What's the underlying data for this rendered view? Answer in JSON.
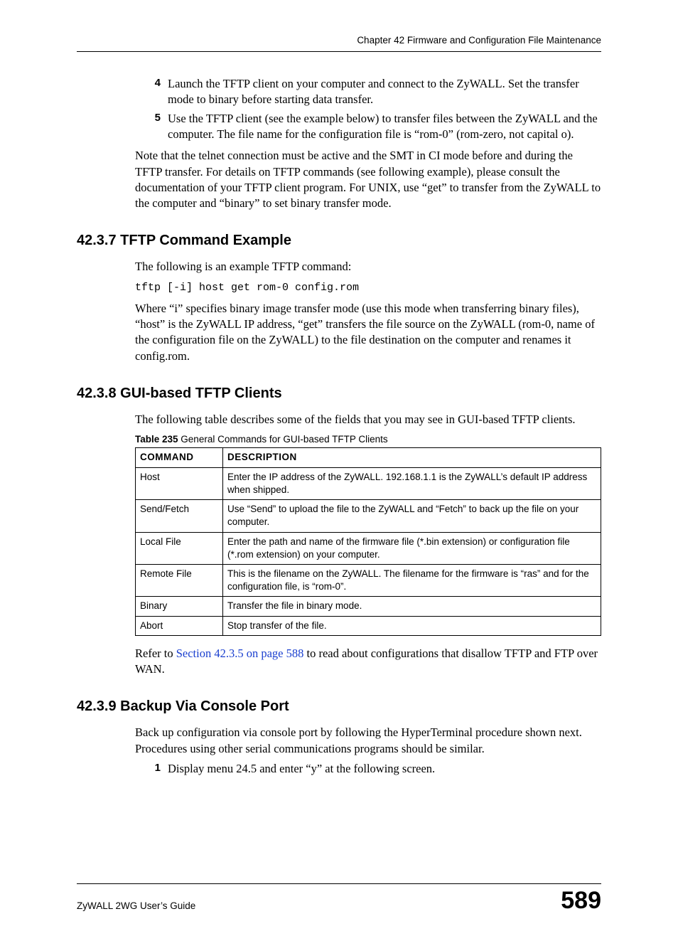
{
  "header": "Chapter 42 Firmware and Configuration File Maintenance",
  "steps_a": [
    {
      "n": "4",
      "t": "Launch the TFTP client on your computer and connect to the ZyWALL. Set the transfer mode to binary before starting data transfer."
    },
    {
      "n": "5",
      "t": "Use the TFTP client (see the example below) to transfer files between the ZyWALL and the computer. The file name for the configuration file is “rom-0” (rom-zero, not capital o)."
    }
  ],
  "note": "Note that the telnet connection must be active and the SMT in CI mode before and during the TFTP transfer. For details on TFTP commands (see following example), please consult the documentation of your TFTP client program. For UNIX, use “get” to transfer from the ZyWALL to the computer and “binary” to set binary transfer mode.",
  "sec7": {
    "h": "42.3.7  TFTP Command Example",
    "p1": "The following is an example TFTP command:",
    "code": "tftp [-i] host get rom-0 config.rom",
    "p2": "Where “i” specifies binary image transfer mode (use this mode when transferring binary files), “host” is the ZyWALL IP address, “get” transfers the file source on the ZyWALL (rom-0, name of the configuration file on the ZyWALL) to the file destination on the computer and renames it config.rom."
  },
  "sec8": {
    "h": "42.3.8  GUI-based TFTP Clients",
    "p1": "The following table describes some of the fields that you may see in GUI-based TFTP clients.",
    "caption_bold": "Table 235",
    "caption_rest": "   General Commands for GUI-based TFTP Clients",
    "th1": "COMMAND",
    "th2": "DESCRIPTION",
    "rows": [
      {
        "c": "Host",
        "d": "Enter the IP address of the ZyWALL. 192.168.1.1 is the ZyWALL’s default IP address when shipped."
      },
      {
        "c": "Send/Fetch",
        "d": "Use “Send” to upload the file to the ZyWALL and “Fetch” to back up the file on your computer."
      },
      {
        "c": "Local File",
        "d": "Enter the path and name of the firmware file (*.bin extension) or configuration file (*.rom extension) on your computer."
      },
      {
        "c": "Remote File",
        "d": "This is the filename on the ZyWALL. The filename for the firmware is “ras” and for the configuration file, is “rom-0”."
      },
      {
        "c": "Binary",
        "d": "Transfer the file in binary mode."
      },
      {
        "c": "Abort",
        "d": "Stop transfer of the file."
      }
    ],
    "refer_pre": "Refer to ",
    "refer_link": "Section 42.3.5 on page 588",
    "refer_post": " to read about configurations that disallow TFTP and FTP over WAN."
  },
  "sec9": {
    "h": "42.3.9  Backup Via Console Port",
    "p1": "Back up configuration via console port by following the HyperTerminal procedure shown next. Procedures using other serial communications programs should be similar.",
    "step1_n": "1",
    "step1_t": "Display menu 24.5 and enter “y” at the following screen."
  },
  "footer": {
    "guide": "ZyWALL 2WG User’s Guide",
    "page": "589"
  }
}
